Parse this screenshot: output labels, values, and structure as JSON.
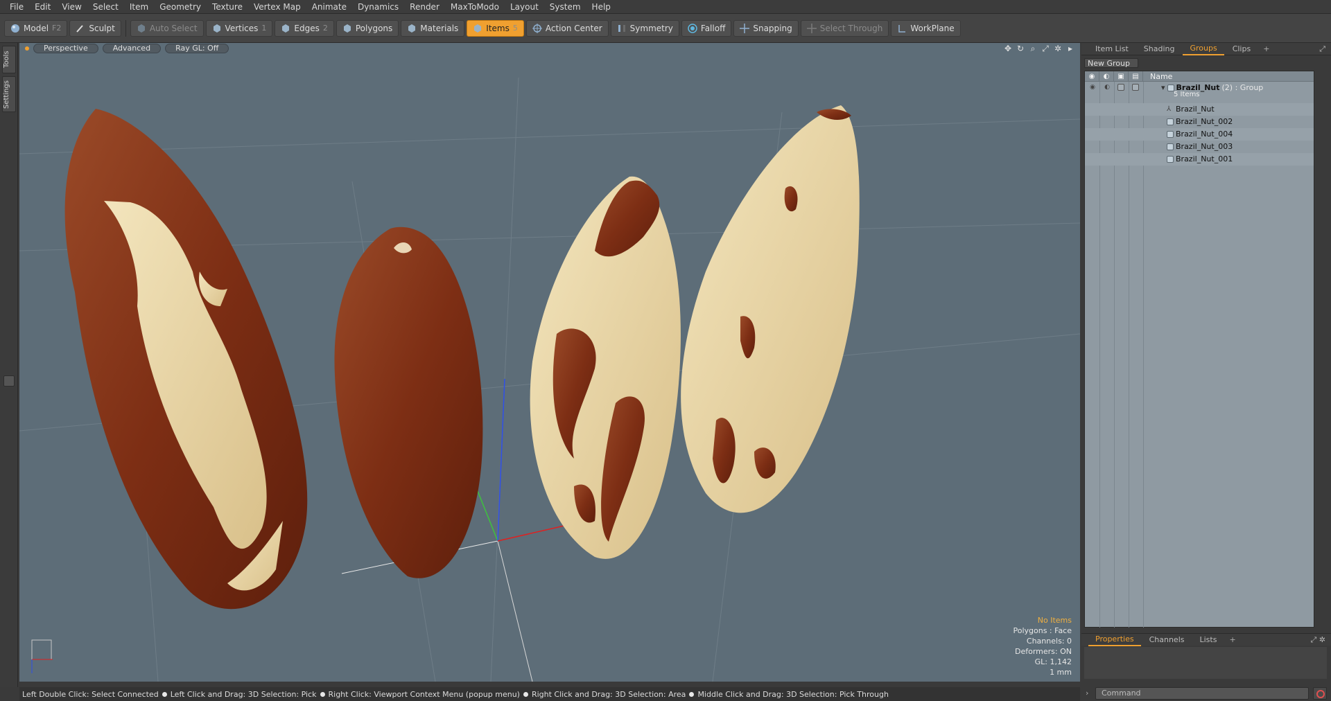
{
  "menu": [
    "File",
    "Edit",
    "View",
    "Select",
    "Item",
    "Geometry",
    "Texture",
    "Vertex Map",
    "Animate",
    "Dynamics",
    "Render",
    "MaxToModo",
    "Layout",
    "System",
    "Help"
  ],
  "toolbar": {
    "model": "Model",
    "model_key": "F2",
    "sculpt": "Sculpt",
    "auto_select": "Auto Select",
    "vertices": "Vertices",
    "vertices_key": "1",
    "edges": "Edges",
    "edges_key": "2",
    "polygons": "Polygons",
    "materials": "Materials",
    "items": "Items",
    "items_key": "5",
    "action_center": "Action Center",
    "symmetry": "Symmetry",
    "falloff": "Falloff",
    "snapping": "Snapping",
    "select_through": "Select Through",
    "workplane": "WorkPlane"
  },
  "left_tabs": [
    "Tools",
    "Settings"
  ],
  "viewport": {
    "view": "Perspective",
    "shading": "Advanced",
    "raygl": "Ray GL: Off",
    "info": {
      "selection": "No Items",
      "polygons": "Polygons : Face",
      "channels": "Channels: 0",
      "deformers": "Deformers: ON",
      "gl": "GL: 1,142",
      "unit": "1 mm"
    }
  },
  "panel_top": {
    "tabs": [
      "Item List",
      "Shading",
      "Groups",
      "Clips"
    ],
    "selected_tab": "Groups",
    "new_group": "New Group",
    "column_name": "Name",
    "group": {
      "name": "Brazil_Nut",
      "suffix": "(2) : Group",
      "count": "5 Items"
    },
    "items": [
      "Brazil_Nut",
      "Brazil_Nut_002",
      "Brazil_Nut_004",
      "Brazil_Nut_003",
      "Brazil_Nut_001"
    ]
  },
  "panel_bottom": {
    "tabs": [
      "Properties",
      "Channels",
      "Lists"
    ],
    "selected_tab": "Properties"
  },
  "status": {
    "hints": [
      "Left Double Click: Select Connected",
      "Left Click and Drag: 3D Selection: Pick",
      "Right Click: Viewport Context Menu (popup menu)",
      "Right Click and Drag: 3D Selection: Area",
      "Middle Click and Drag: 3D Selection: Pick Through"
    ],
    "command_placeholder": "Command"
  },
  "colors": {
    "accent": "#f0a030",
    "viewport_bg": "#5d6d78",
    "nut_dark": "#8a3418",
    "nut_light": "#efdcae"
  }
}
